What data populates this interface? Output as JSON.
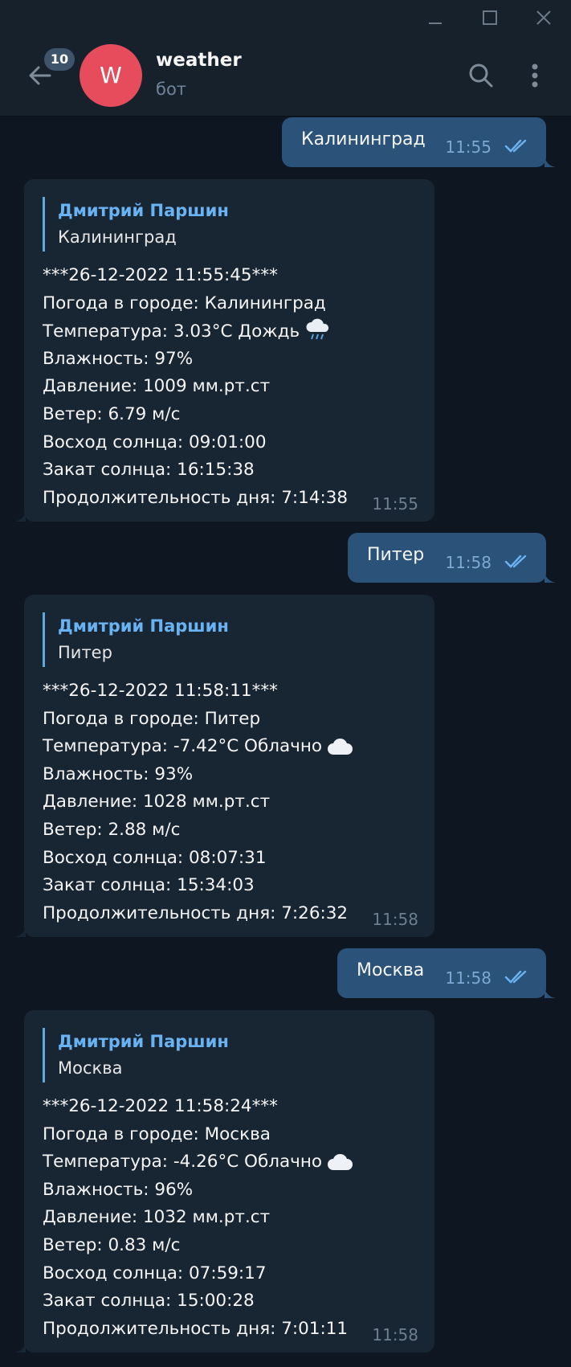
{
  "header": {
    "title": "weather",
    "status": "бот",
    "unread_count": "10",
    "avatar_letter": "W"
  },
  "messages": [
    {
      "outgoing_text": "Калининград",
      "outgoing_time": "11:55",
      "reply_author": "Дмитрий Паршин",
      "reply_text": "Калининград",
      "lines": [
        "***26-12-2022 11:55:45***",
        "Погода в городе: Калининград",
        "Температура: 3.03°C Дождь",
        "Влажность: 97%",
        "Давление: 1009 мм.рт.ст",
        "Ветер: 6.79 м/с",
        "Восход солнца: 09:01:00",
        "Закат солнца: 16:15:38",
        "Продолжительность дня: 7:14:38"
      ],
      "weather_icon": "rain-cloud-icon",
      "time": "11:55"
    },
    {
      "outgoing_text": "Питер",
      "outgoing_time": "11:58",
      "reply_author": "Дмитрий Паршин",
      "reply_text": "Питер",
      "lines": [
        "***26-12-2022 11:58:11***",
        "Погода в городе: Питер",
        "Температура: -7.42°C Облачно",
        "Влажность: 93%",
        "Давление: 1028 мм.рт.ст",
        "Ветер: 2.88 м/с",
        "Восход солнца: 08:07:31",
        "Закат солнца: 15:34:03",
        "Продолжительность дня: 7:26:32"
      ],
      "weather_icon": "cloud-icon",
      "time": "11:58"
    },
    {
      "outgoing_text": "Москва",
      "outgoing_time": "11:58",
      "reply_author": "Дмитрий Паршин",
      "reply_text": "Москва",
      "lines": [
        "***26-12-2022 11:58:24***",
        "Погода в городе: Москва",
        "Температура: -4.26°C Облачно",
        "Влажность: 96%",
        "Давление: 1032 мм.рт.ст",
        "Ветер: 0.83 м/с",
        "Восход солнца: 07:59:17",
        "Закат солнца: 15:00:28",
        "Продолжительность дня: 7:01:11"
      ],
      "weather_icon": "cloud-icon",
      "time": "11:58"
    }
  ],
  "colors": {
    "background": "#0e1621",
    "header": "#17212b",
    "outgoing_bubble": "#2b5278",
    "incoming_bubble": "#182533",
    "avatar": "#e74c5c",
    "link": "#6ab3f3"
  }
}
